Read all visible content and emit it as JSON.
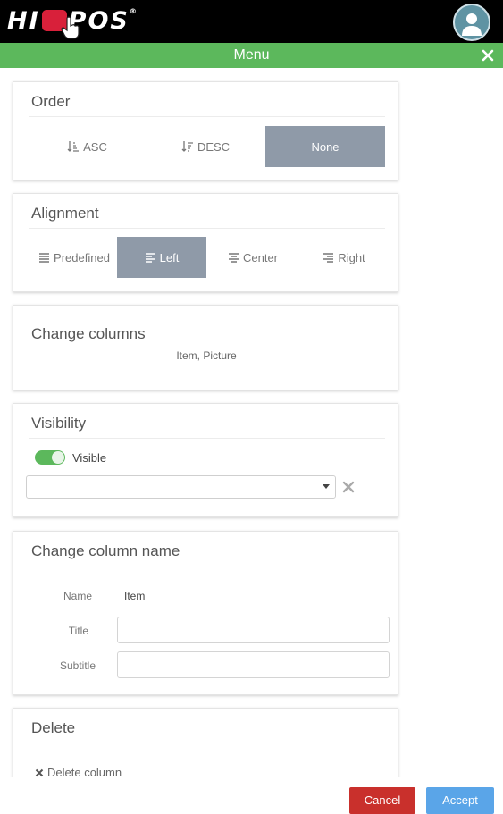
{
  "header": {
    "logo_text_left": "HI",
    "logo_text_right": "POS",
    "logo_tm": "®",
    "logo_icon": "pointing-hand-icon",
    "avatar_icon": "user-icon"
  },
  "menubar": {
    "title": "Menu",
    "close_icon": "close-icon",
    "color": "#5cb85c"
  },
  "order": {
    "title": "Order",
    "options": [
      {
        "label": "ASC",
        "icon": "sort-asc-icon",
        "active": false
      },
      {
        "label": "DESC",
        "icon": "sort-desc-icon",
        "active": false
      },
      {
        "label": "None",
        "icon": "",
        "active": true
      }
    ]
  },
  "alignment": {
    "title": "Alignment",
    "options": [
      {
        "label": "Predefined",
        "icon": "align-justify-icon",
        "active": false
      },
      {
        "label": "Left",
        "icon": "align-left-icon",
        "active": true
      },
      {
        "label": "Center",
        "icon": "align-center-icon",
        "active": false
      },
      {
        "label": "Right",
        "icon": "align-right-icon",
        "active": false
      }
    ]
  },
  "columns": {
    "title": "Change columns",
    "value": "Item, Picture"
  },
  "visibility": {
    "title": "Visibility",
    "toggle_label": "Visible",
    "toggle_on": true,
    "select_value": ""
  },
  "column_name": {
    "title": "Change column name",
    "name_label": "Name",
    "name_value": "Item",
    "title_label": "Title",
    "title_value": "",
    "subtitle_label": "Subtitle",
    "subtitle_value": ""
  },
  "delete": {
    "title": "Delete",
    "link_label": "Delete column"
  },
  "footer": {
    "cancel_label": "Cancel",
    "accept_label": "Accept",
    "cancel_color": "#c9302c",
    "accept_color": "#5aa5e8"
  },
  "colors": {
    "active_segment": "#8f9aa8"
  }
}
